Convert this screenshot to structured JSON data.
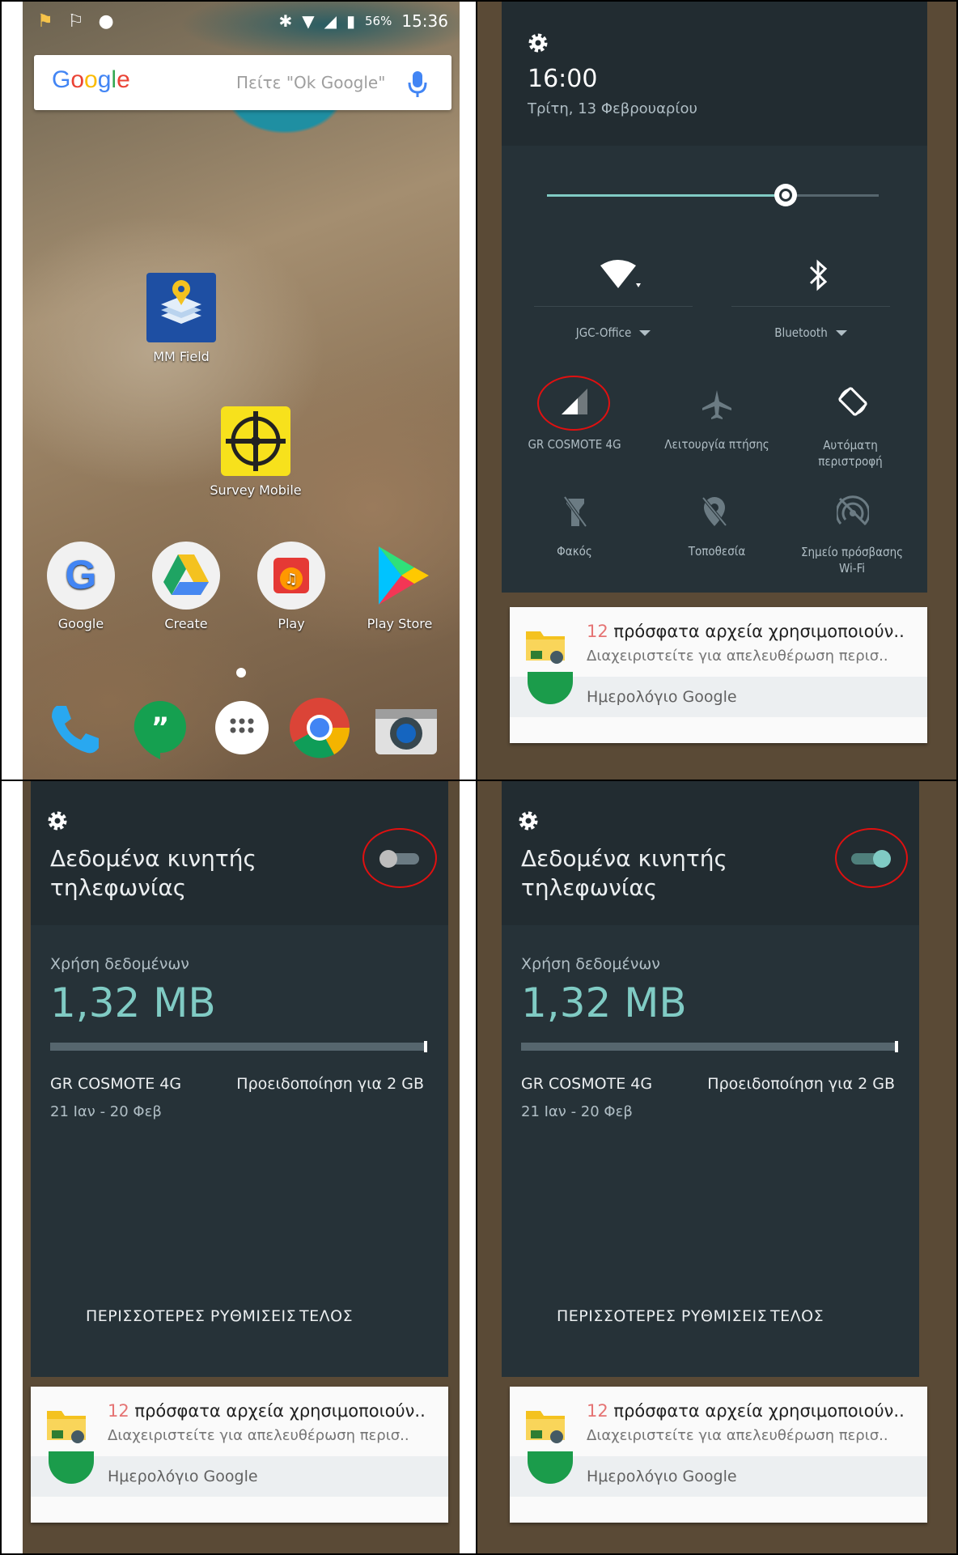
{
  "home": {
    "status_time": "15:36",
    "battery_pct": "56%",
    "search_hint": "Πείτε \"Ok Google\"",
    "google_logo": "Google",
    "apps": {
      "mm_field": "MM Field",
      "survey_mobile": "Survey Mobile",
      "google": "Google",
      "create": "Create",
      "play": "Play",
      "play_store": "Play Store"
    }
  },
  "quick_settings": {
    "time": "16:00",
    "date": "Τρίτη, 13 Φεβρουαρίου",
    "brightness_level": 0.72,
    "wifi_label": "JGC-Office",
    "bluetooth_label": "Bluetooth",
    "tiles": {
      "mobile": "GR COSMOTE 4G",
      "airplane": "Λειτουργία πτήσης",
      "rotate_line1": "Αυτόματη",
      "rotate_line2": "περιστροφή",
      "flashlight": "Φακός",
      "location": "Τοποθεσία",
      "hotspot_line1": "Σημείο πρόσβασης",
      "hotspot_line2": "Wi-Fi"
    }
  },
  "notification": {
    "count": "12",
    "title_rest": "πρόσφατα αρχεία χρησιμοποιούν..",
    "subtitle": "Διαχειριστείτε για απελευθέρωση περισ..",
    "calendar": "Ημερολόγιο Google"
  },
  "mobile_data": {
    "title_line1": "Δεδομένα κινητής",
    "title_line2": "τηλεφωνίας",
    "usage_label": "Χρήση δεδομένων",
    "usage_value": "1,32 MB",
    "carrier": "GR COSMOTE 4G",
    "warning": "Προειδοποίηση για 2 GB",
    "range": "21 Ιαν - 20 Φεβ",
    "more_settings": "ΠΕΡΙΣΣΟΤΕΡΕΣ ΡΥΘΜΙΣΕΙΣ",
    "done": "ΤΕΛΟΣ",
    "toggle_off_state": "off",
    "toggle_on_state": "on",
    "accent": "#80cbc4"
  }
}
